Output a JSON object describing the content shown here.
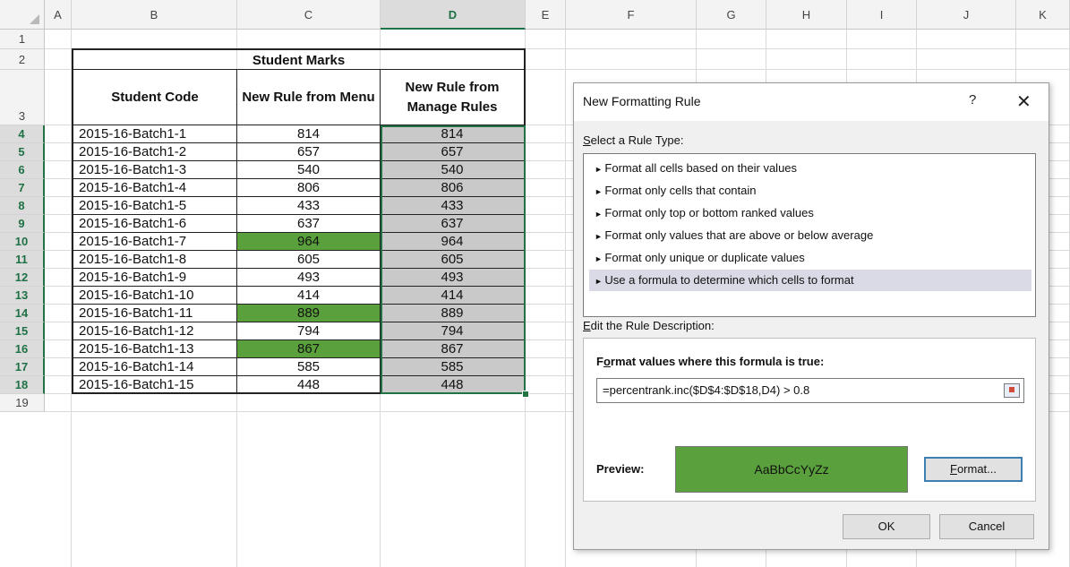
{
  "columns": [
    "A",
    "B",
    "C",
    "D",
    "E",
    "F",
    "G",
    "H",
    "I",
    "J",
    "K"
  ],
  "rows": [
    "1",
    "2",
    "3",
    "4",
    "5",
    "6",
    "7",
    "8",
    "9",
    "10",
    "11",
    "12",
    "13",
    "14",
    "15",
    "16",
    "17",
    "18",
    "19"
  ],
  "table": {
    "title": "Student Marks",
    "headers": {
      "code": "Student Code",
      "menu": "New Rule from Menu",
      "manage": "New Rule from Manage Rules"
    },
    "data": [
      {
        "code": "2015-16-Batch1-1",
        "menu": "814",
        "manage": "814",
        "highlight": false
      },
      {
        "code": "2015-16-Batch1-2",
        "menu": "657",
        "manage": "657",
        "highlight": false
      },
      {
        "code": "2015-16-Batch1-3",
        "menu": "540",
        "manage": "540",
        "highlight": false
      },
      {
        "code": "2015-16-Batch1-4",
        "menu": "806",
        "manage": "806",
        "highlight": false
      },
      {
        "code": "2015-16-Batch1-5",
        "menu": "433",
        "manage": "433",
        "highlight": false
      },
      {
        "code": "2015-16-Batch1-6",
        "menu": "637",
        "manage": "637",
        "highlight": false
      },
      {
        "code": "2015-16-Batch1-7",
        "menu": "964",
        "manage": "964",
        "highlight": true
      },
      {
        "code": "2015-16-Batch1-8",
        "menu": "605",
        "manage": "605",
        "highlight": false
      },
      {
        "code": "2015-16-Batch1-9",
        "menu": "493",
        "manage": "493",
        "highlight": false
      },
      {
        "code": "2015-16-Batch1-10",
        "menu": "414",
        "manage": "414",
        "highlight": false
      },
      {
        "code": "2015-16-Batch1-11",
        "menu": "889",
        "manage": "889",
        "highlight": true
      },
      {
        "code": "2015-16-Batch1-12",
        "menu": "794",
        "manage": "794",
        "highlight": false
      },
      {
        "code": "2015-16-Batch1-13",
        "menu": "867",
        "manage": "867",
        "highlight": true
      },
      {
        "code": "2015-16-Batch1-14",
        "menu": "585",
        "manage": "585",
        "highlight": false
      },
      {
        "code": "2015-16-Batch1-15",
        "menu": "448",
        "manage": "448",
        "highlight": false
      }
    ]
  },
  "colors": {
    "highlight_green": "#5aa03c",
    "selection_gray": "#c9c9c9",
    "excel_green": "#217346"
  },
  "dialog": {
    "title": "New Formatting Rule",
    "help": "?",
    "close": "✕",
    "select_label_first": "S",
    "select_label_rest": "elect a Rule Type:",
    "rule_types": [
      "Format all cells based on their values",
      "Format only cells that contain",
      "Format only top or bottom ranked values",
      "Format only values that are above or below average",
      "Format only unique or duplicate values",
      "Use a formula to determine which cells to format"
    ],
    "selected_rule_index": 5,
    "edit_label_first": "E",
    "edit_label_rest": "dit the Rule Description:",
    "formula_label_a": "F",
    "formula_label_b": "o",
    "formula_label_c": "rmat values where this formula is true:",
    "formula": "=percentrank.inc($D$4:$D$18,D4) > 0.8",
    "preview_label": "Preview:",
    "preview_text": "AaBbCcYyZz",
    "format_button_first": "F",
    "format_button_rest": "ormat...",
    "ok": "OK",
    "cancel": "Cancel"
  }
}
